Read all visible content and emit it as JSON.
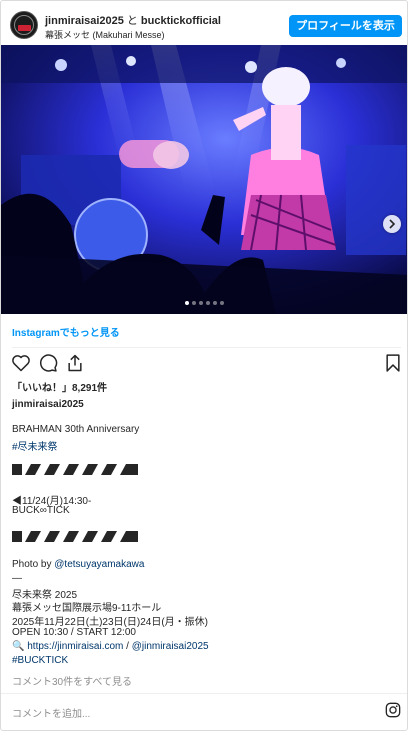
{
  "header": {
    "account1": "jinmiraisai2025",
    "separator": "と",
    "account2": "bucktickofficial",
    "location": "幕張メッセ (Makuhari Messe)",
    "profile_button": "プロフィールを表示"
  },
  "carousel": {
    "slides": 6,
    "active_index": 0
  },
  "icons": {
    "like": "heart-icon",
    "comment": "comment-icon",
    "share": "share-icon",
    "save": "bookmark-icon",
    "next": "chevron-right-icon",
    "logo": "instagram-icon"
  },
  "colors": {
    "accent": "#0095f6",
    "hashtag": "#00376b",
    "muted": "#8e8e8e"
  },
  "more_link": "Instagramでもっと見る",
  "likes": "「いいね！」8,291件",
  "caption": {
    "user": "jinmiraisai2025",
    "lines": {
      "l1": "BRAHMAN 30th Anniversary",
      "l2": "#尽未来祭",
      "l3": "◀11/24(月)14:30-",
      "l4": "BUCK∞TICK",
      "l5_prefix": "Photo by ",
      "l5_mention": "@tetsuyayamakawa",
      "l6": "—",
      "l7": "尽未来祭 2025",
      "l8": "幕張メッセ国際展示場9-11ホール",
      "l9": "2025年11月22日(土)23日(日)24日(月・振休)",
      "l10": "OPEN 10:30 / START 12:00",
      "l11_prefix": "🔍 ",
      "l11_link": "https://jinmiraisai.com",
      "l11_sep": " / ",
      "l11_mention": "@jinmiraisai2025",
      "l12": "#BUCKTICK"
    }
  },
  "comments_link": "コメント30件をすべて見る",
  "comment_placeholder": "コメントを追加..."
}
